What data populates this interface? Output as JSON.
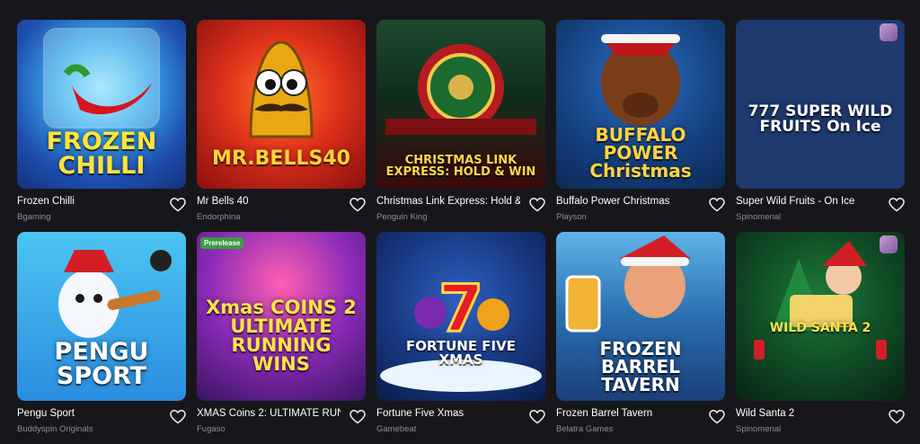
{
  "games": [
    {
      "name": "Frozen Chilli",
      "provider": "Bgaming",
      "art": "FROZEN CHILLI"
    },
    {
      "name": "Mr Bells 40",
      "provider": "Endorphina",
      "art": "MR.BELLS40"
    },
    {
      "name": "Christmas Link Express: Hold & ...",
      "provider": "Penguin King",
      "art": "CHRISTMAS LINK EXPRESS: HOLD & WIN"
    },
    {
      "name": "Buffalo Power Christmas",
      "provider": "Playson",
      "art": "BUFFALO POWER Christmas"
    },
    {
      "name": "Super Wild Fruits - On Ice",
      "provider": "Spinomenal",
      "art": "777 SUPER WILD FRUITS On Ice",
      "studio": "Spinomenal"
    },
    {
      "name": "Pengu Sport",
      "provider": "Buddyspin Originals",
      "art": "PENGU SPORT"
    },
    {
      "name": "XMAS Coins 2: ULTIMATE RUNN...",
      "provider": "Fugaso",
      "art": "Xmas COINS 2 ULTIMATE RUNNING WINS",
      "badge": "Prerelease"
    },
    {
      "name": "Fortune Five Xmas",
      "provider": "Gamebeat",
      "art": "FORTUNE FIVE XMAS"
    },
    {
      "name": "Frozen Barrel Tavern",
      "provider": "Belatra Games",
      "art": "FROZEN BARREL TAVERN"
    },
    {
      "name": "Wild Santa 2",
      "provider": "Spinomenal",
      "art": "WILD SANTA 2",
      "studio": "Spinomenal"
    }
  ],
  "colors": {
    "background": "#17171b",
    "provider_text": "#8c8c95",
    "badge": "#3b9c3f"
  },
  "icons": {
    "favorite": "heart-outline-icon"
  }
}
